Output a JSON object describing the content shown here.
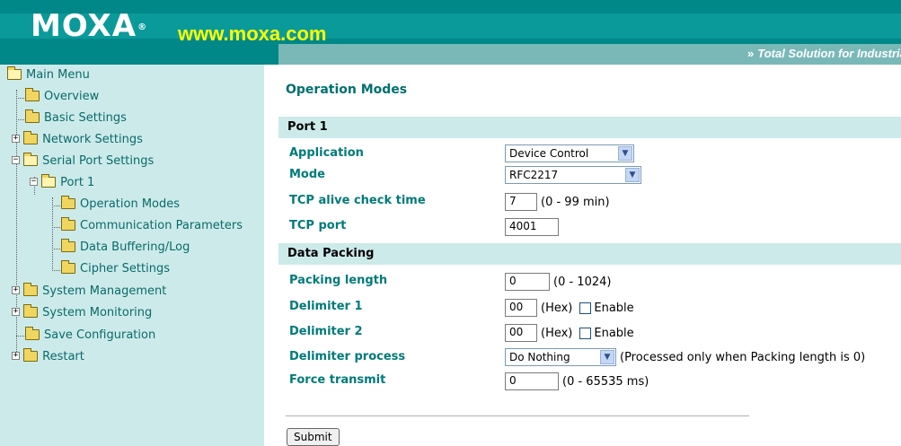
{
  "header": {
    "brand": "MOXA",
    "reg_mark": "®",
    "site": "www.moxa.com",
    "tagline_arrow": "»",
    "tagline": "Total Solution for Industrial Wir",
    "colors": {
      "teal": "#008787",
      "yellow": "#ffff00",
      "sidebar": "#cdeaea"
    }
  },
  "menu": {
    "main": "Main Menu",
    "overview": "Overview",
    "basic_settings": "Basic Settings",
    "network_settings": "Network Settings",
    "serial_port_settings": "Serial Port Settings",
    "port1": "Port 1",
    "operation_modes": "Operation Modes",
    "communication_parameters": "Communication Parameters",
    "data_buffering": "Data Buffering/Log",
    "cipher_settings": "Cipher Settings",
    "system_management": "System Management",
    "system_monitoring": "System Monitoring",
    "save_configuration": "Save Configuration",
    "restart": "Restart",
    "expand_plus": "+",
    "expand_minus": "−"
  },
  "main": {
    "title": "Operation Modes",
    "port_section": "Port 1",
    "application_label": "Application",
    "application_value": "Device Control",
    "mode_label": "Mode",
    "mode_value": "RFC2217",
    "tcp_alive_label": "TCP alive check time",
    "tcp_alive_value": "7",
    "tcp_alive_hint": "(0 - 99 min)",
    "tcp_port_label": "TCP port",
    "tcp_port_value": "4001",
    "packing_section": "Data Packing",
    "packing_length_label": "Packing length",
    "packing_length_value": "0",
    "packing_length_hint": "(0 - 1024)",
    "delimiter1_label": "Delimiter 1",
    "delimiter1_value": "00",
    "delimiter2_label": "Delimiter 2",
    "delimiter2_value": "00",
    "hex_hint": "(Hex)",
    "enable_label": "Enable",
    "delimiter_process_label": "Delimiter process",
    "delimiter_process_value": "Do Nothing",
    "delimiter_process_hint": "(Processed only when Packing length is 0)",
    "force_transmit_label": "Force transmit",
    "force_transmit_value": "0",
    "force_transmit_hint": "(0 - 65535 ms)",
    "submit": "Submit",
    "dropdown_arrow": "▼"
  }
}
